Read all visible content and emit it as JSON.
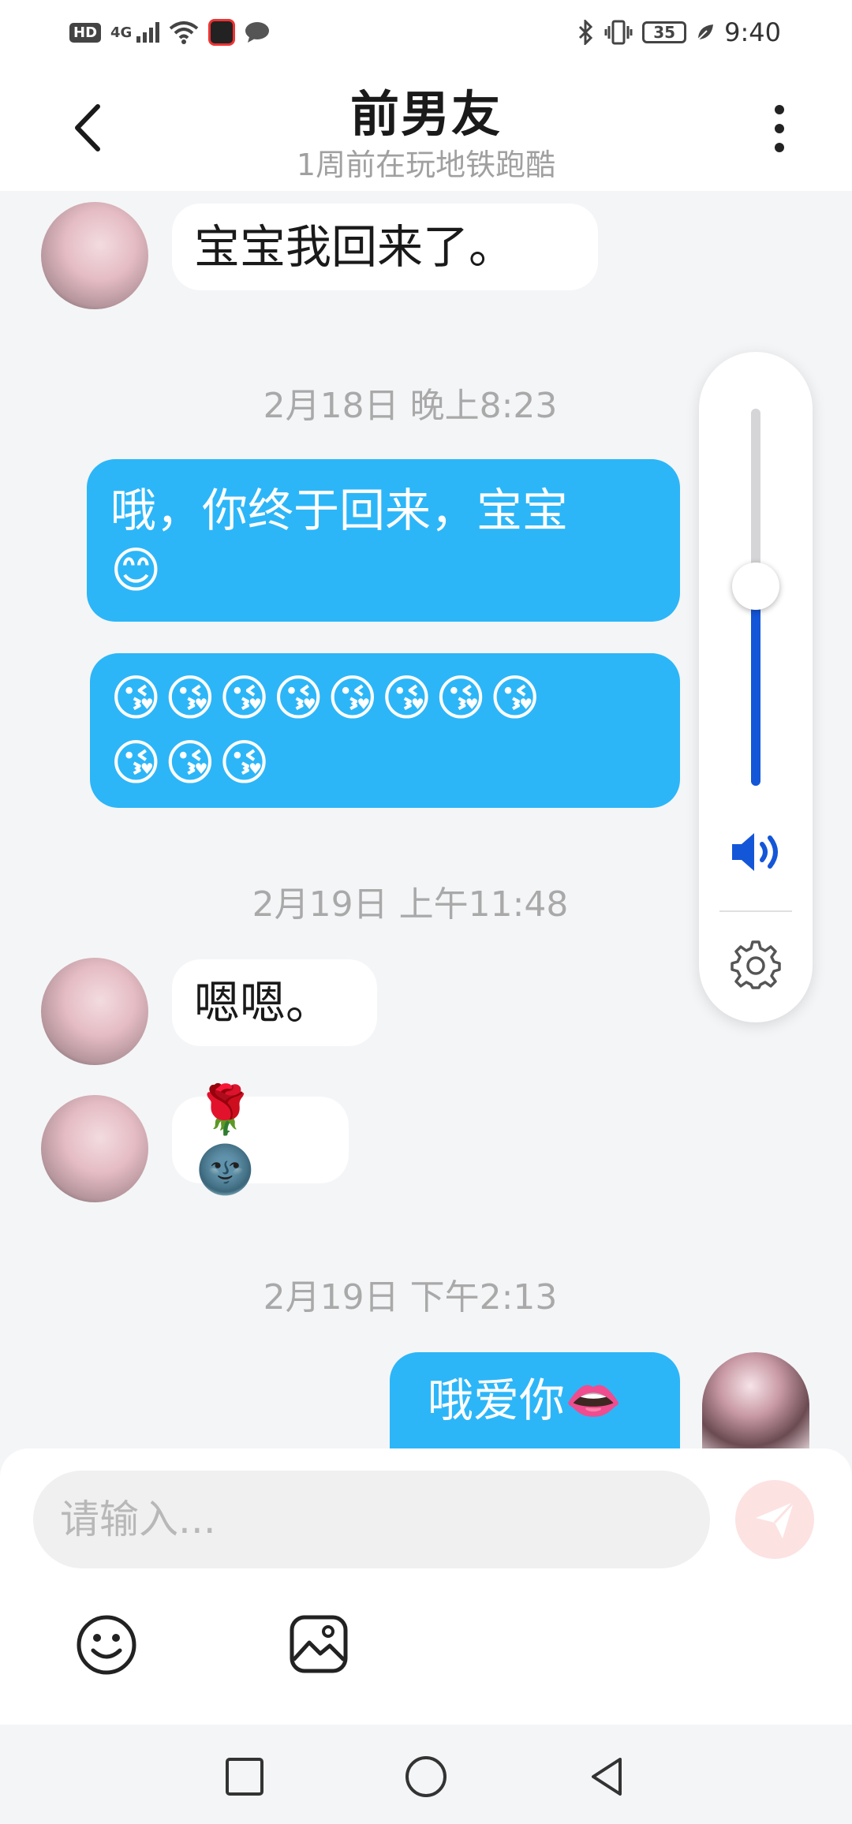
{
  "status_bar": {
    "hd_label": "HD",
    "network_label": "4G",
    "battery_level": "35",
    "time": "9:40",
    "icons": [
      "hd-icon",
      "signal-icon",
      "wifi-icon",
      "app-notification-icon",
      "chat-notification-icon",
      "bluetooth-icon",
      "vibrate-icon",
      "battery-icon",
      "eco-leaf-icon"
    ]
  },
  "header": {
    "title": "前男友",
    "subtitle": "1周前在玩地铁跑酷",
    "back_icon": "chevron-left-icon",
    "more_icon": "more-vertical-icon"
  },
  "messages": [
    {
      "side": "in",
      "text": "宝宝我回来了。"
    },
    {
      "type": "timestamp",
      "text": "2月18日 晚上8:23"
    },
    {
      "side": "out",
      "text_line1": "哦，你终于回来，宝宝",
      "text_line2": "😊"
    },
    {
      "side": "out",
      "emoji_line1": "😘😘😘😘😘😘😘😘",
      "emoji_line2": "😘😘😘"
    },
    {
      "type": "timestamp",
      "text": "2月19日 上午11:48"
    },
    {
      "side": "in",
      "text": "嗯嗯。"
    },
    {
      "side": "in",
      "text": "🌹🌚"
    },
    {
      "type": "timestamp",
      "text": "2月19日 下午2:13"
    },
    {
      "side": "out",
      "text": "哦爱你👄"
    }
  ],
  "volume_panel": {
    "level_percent": 53,
    "speaker_icon": "speaker-icon",
    "settings_icon": "gear-icon",
    "colors": {
      "fill": "#1456d8",
      "track": "#d5d5d8"
    }
  },
  "composer": {
    "placeholder": "请输入...",
    "value": "",
    "send_icon": "send-icon",
    "emoji_icon": "smiley-icon",
    "image_icon": "image-icon"
  },
  "nav_bar": {
    "icons": [
      "recents-square-icon",
      "home-circle-icon",
      "back-triangle-icon"
    ]
  },
  "colors": {
    "outgoing_bubble": "#2cb6f8",
    "incoming_bubble": "#ffffff",
    "background": "#f4f5f7"
  }
}
